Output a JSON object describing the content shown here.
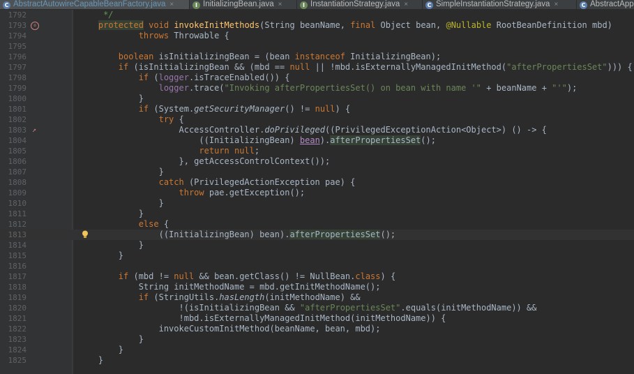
{
  "tabs": [
    {
      "label": "AbstractAutowireCapableBeanFactory.java",
      "icon": "c",
      "active": true
    },
    {
      "label": "InitializingBean.java",
      "icon": "i",
      "active": false
    },
    {
      "label": "InstantiationStrategy.java",
      "icon": "i",
      "active": false
    },
    {
      "label": "SimpleInstantiationStrategy.java",
      "icon": "c",
      "active": false
    },
    {
      "label": "AbstractApp",
      "icon": "c",
      "active": false
    }
  ],
  "close_glyph": "×",
  "colors": {
    "background": "#2b2b2b",
    "keyword": "#cc7832",
    "method": "#ffc66d",
    "string": "#6a8759",
    "field": "#9876aa"
  },
  "line_numbers": [
    "1792",
    "1793",
    "1794",
    "1795",
    "1796",
    "1797",
    "1798",
    "1799",
    "1800",
    "1801",
    "1802",
    "1803",
    "1804",
    "1805",
    "1806",
    "1807",
    "1808",
    "1809",
    "1810",
    "1811",
    "1812",
    "1813",
    "1814",
    "1815",
    "1816",
    "1817",
    "1818",
    "1819",
    "1820",
    "1821",
    "1822",
    "1823",
    "1824",
    "1825"
  ],
  "code_lines": [
    "\t */",
    "\tprotected void invokeInitMethods(String beanName, final Object bean, @Nullable RootBeanDefinition mbd)",
    "\t\t\tthrows Throwable {",
    "",
    "\t\tboolean isInitializingBean = (bean instanceof InitializingBean);",
    "\t\tif (isInitializingBean && (mbd == null || !mbd.isExternallyManagedInitMethod(\"afterPropertiesSet\"))) {",
    "\t\t\tif (logger.isTraceEnabled()) {",
    "\t\t\t\tlogger.trace(\"Invoking afterPropertiesSet() on bean with name '\" + beanName + \"'\");",
    "\t\t\t}",
    "\t\t\tif (System.getSecurityManager() != null) {",
    "\t\t\t\ttry {",
    "\t\t\t\t\tAccessController.doPrivileged((PrivilegedExceptionAction<Object>) () -> {",
    "\t\t\t\t\t\t((InitializingBean) bean).afterPropertiesSet();",
    "\t\t\t\t\t\treturn null;",
    "\t\t\t\t\t}, getAccessControlContext());",
    "\t\t\t\t}",
    "\t\t\t\tcatch (PrivilegedActionException pae) {",
    "\t\t\t\t\tthrow pae.getException();",
    "\t\t\t\t}",
    "\t\t\t}",
    "\t\t\telse {",
    "\t\t\t\t((InitializingBean) bean).afterPropertiesSet();",
    "\t\t\t}",
    "\t\t}",
    "",
    "\t\tif (mbd != null && bean.getClass() != NullBean.class) {",
    "\t\t\tString initMethodName = mbd.getInitMethodName();",
    "\t\t\tif (StringUtils.hasLength(initMethodName) &&",
    "\t\t\t\t\t!(isInitializingBean && \"afterPropertiesSet\".equals(initMethodName)) &&",
    "\t\t\t\t\t!mbd.isExternallyManagedInitMethod(initMethodName)) {",
    "\t\t\t\tinvokeCustomInitMethod(beanName, bean, mbd);",
    "\t\t\t}",
    "\t\t}",
    "\t}"
  ],
  "gutter_icons": [
    {
      "line": "1793",
      "icon": "override-method-icon"
    },
    {
      "line": "1803",
      "icon": "lambda-icon"
    },
    {
      "line": "1813",
      "icon": "lightbulb-icon"
    }
  ]
}
